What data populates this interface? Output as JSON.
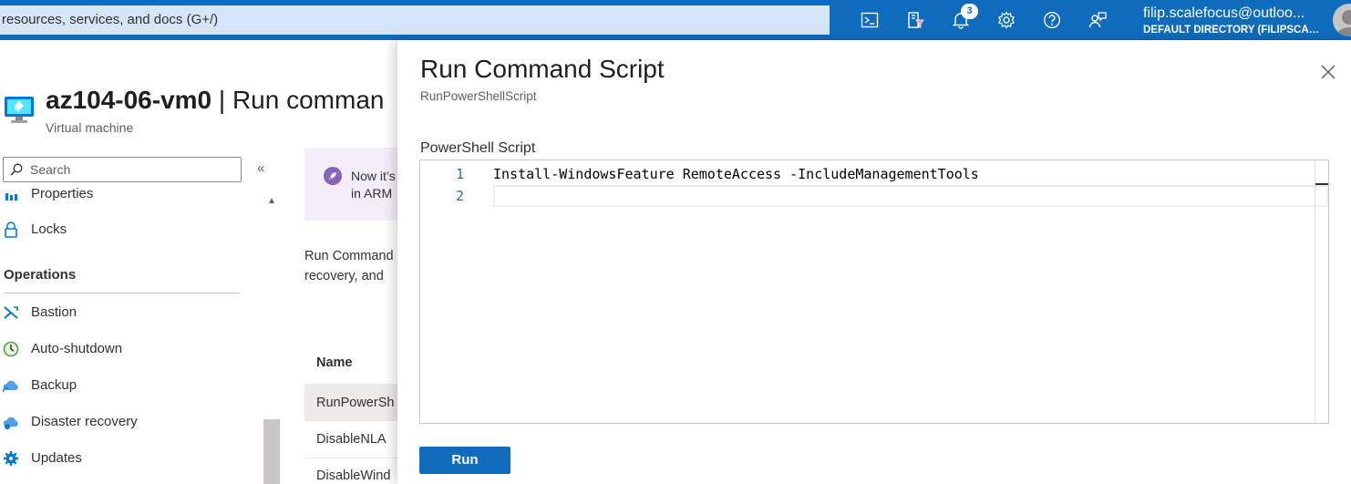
{
  "topbar": {
    "search_text": "resources, services, and docs (G+/)",
    "notification_count": "3",
    "account_name": "filip.scalefocus@outloo...",
    "account_directory": "DEFAULT DIRECTORY (FILIPSCALE...",
    "icons": [
      "cloud-shell-icon",
      "directory-filter-icon",
      "notifications-icon",
      "settings-icon",
      "help-icon",
      "feedback-icon"
    ]
  },
  "resource": {
    "name": "az104-06-vm0",
    "page": " | Run comman",
    "type": "Virtual machine"
  },
  "sidebar": {
    "search_placeholder": "Search",
    "collapse": "«",
    "items_top": [
      {
        "label": "Properties",
        "icon": "properties-icon"
      },
      {
        "label": "Locks",
        "icon": "lock-icon"
      }
    ],
    "section": "Operations",
    "items": [
      {
        "label": "Bastion",
        "icon": "bastion-icon"
      },
      {
        "label": "Auto-shutdown",
        "icon": "clock-icon"
      },
      {
        "label": "Backup",
        "icon": "backup-cloud-icon"
      },
      {
        "label": "Disaster recovery",
        "icon": "disaster-recovery-icon"
      },
      {
        "label": "Updates",
        "icon": "gear-icon"
      }
    ]
  },
  "main": {
    "info_line1": "Now it’s",
    "info_line2": "in ARM",
    "desc_line1": "Run Command",
    "desc_line2": "recovery, and",
    "col_name": "Name",
    "rows": [
      "RunPowerSh",
      "DisableNLA",
      "DisableWind"
    ]
  },
  "panel": {
    "title": "Run Command Script",
    "subtitle": "RunPowerShellScript",
    "script_label": "PowerShell Script",
    "lines": [
      {
        "num": "1",
        "code": "Install-WindowsFeature RemoteAccess -IncludeManagementTools"
      },
      {
        "num": "2",
        "code": ""
      }
    ],
    "run_label": "Run"
  },
  "colors": {
    "brand_blue": "#0f6cbd",
    "purple_info": "#8764b8"
  }
}
